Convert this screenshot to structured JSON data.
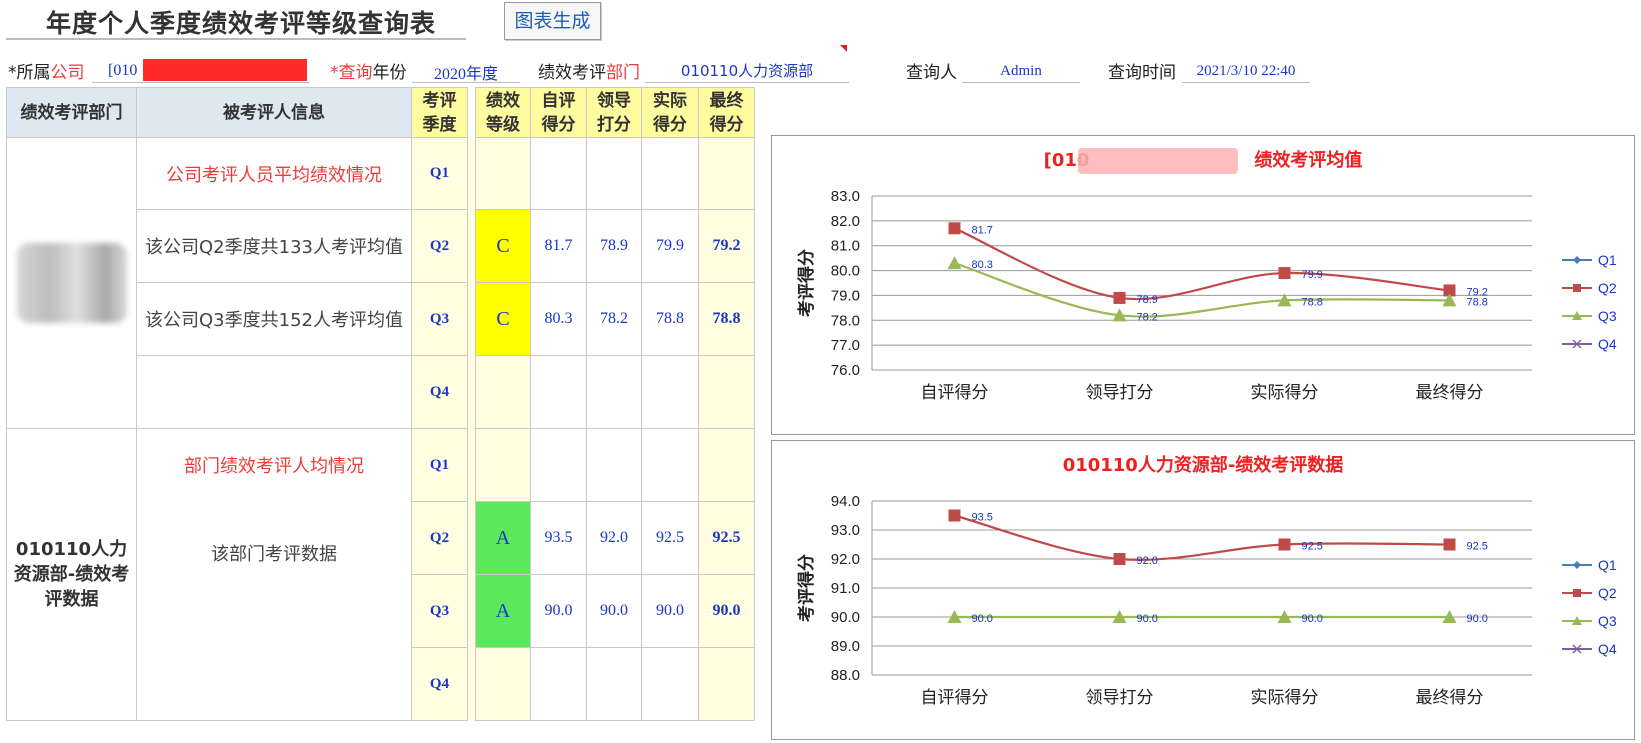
{
  "header": {
    "title": "年度个人季度绩效考评等级查询表",
    "generate_button": "图表生成"
  },
  "filters": {
    "company_label_prefix": "*所属",
    "company_label_red": "公司",
    "company_value": "[010",
    "year_label_red": "*查询",
    "year_label_suffix": "年份",
    "year_value_num": "2020",
    "year_value_suffix": "年度",
    "dept_label_prefix": "绩效考评",
    "dept_label_red": "部门",
    "dept_value": "010110人力资源部",
    "reviewer_label": "查询人",
    "reviewer_value": "Admin",
    "time_label": "查询时间",
    "time_value": "2021/3/10 22:40"
  },
  "table": {
    "headers": {
      "dept": "绩效考评部门",
      "info": "被考评人信息",
      "quarter_l1": "考评",
      "quarter_l2": "季度",
      "grade_l1": "绩效",
      "grade_l2": "等级",
      "self_l1": "自评",
      "self_l2": "得分",
      "leader_l1": "领导",
      "leader_l2": "打分",
      "actual_l1": "实际",
      "actual_l2": "得分",
      "final_l1": "最终",
      "final_l2": "得分"
    },
    "company_section": {
      "title": "公司考评人员平均绩效情况",
      "rows": [
        {
          "quarter": "Q1",
          "info": "",
          "grade": "",
          "self": "",
          "leader": "",
          "actual": "",
          "final": ""
        },
        {
          "quarter": "Q2",
          "info": "该公司Q2季度共133人考评均值",
          "grade": "C",
          "self": "81.7",
          "leader": "78.9",
          "actual": "79.9",
          "final": "79.2"
        },
        {
          "quarter": "Q3",
          "info": "该公司Q3季度共152人考评均值",
          "grade": "C",
          "self": "80.3",
          "leader": "78.2",
          "actual": "78.8",
          "final": "78.8"
        },
        {
          "quarter": "Q4",
          "info": "",
          "grade": "",
          "self": "",
          "leader": "",
          "actual": "",
          "final": ""
        }
      ]
    },
    "dept_section": {
      "dept_name": "010110人力资源部-绩效考评数据",
      "title": "部门绩效考评人均情况",
      "info": "该部门考评数据",
      "rows": [
        {
          "quarter": "Q1",
          "grade": "",
          "self": "",
          "leader": "",
          "actual": "",
          "final": ""
        },
        {
          "quarter": "Q2",
          "grade": "A",
          "self": "93.5",
          "leader": "92.0",
          "actual": "92.5",
          "final": "92.5"
        },
        {
          "quarter": "Q3",
          "grade": "A",
          "self": "90.0",
          "leader": "90.0",
          "actual": "90.0",
          "final": "90.0"
        },
        {
          "quarter": "Q4",
          "grade": "",
          "self": "",
          "leader": "",
          "actual": "",
          "final": ""
        }
      ]
    }
  },
  "colors": {
    "Q1": "#4a7ebb",
    "Q2": "#be4b48",
    "Q3": "#98b954",
    "Q4": "#7d60a0"
  },
  "chart_data": [
    {
      "type": "line",
      "title": "[010",
      "title_suffix": "绩效考评均值",
      "ylabel": "考评得分",
      "categories": [
        "自评得分",
        "领导打分",
        "实际得分",
        "最终得分"
      ],
      "ylim": [
        76.0,
        83.0
      ],
      "ystep": 1.0,
      "legend": "right",
      "series": [
        {
          "name": "Q1",
          "values": []
        },
        {
          "name": "Q2",
          "values": [
            81.7,
            78.9,
            79.9,
            79.2
          ]
        },
        {
          "name": "Q3",
          "values": [
            80.3,
            78.2,
            78.8,
            78.8
          ]
        },
        {
          "name": "Q4",
          "values": []
        }
      ]
    },
    {
      "type": "line",
      "title": "010110人力资源部-绩效考评数据",
      "title_suffix": "",
      "ylabel": "考评得分",
      "categories": [
        "自评得分",
        "领导打分",
        "实际得分",
        "最终得分"
      ],
      "ylim": [
        88.0,
        94.0
      ],
      "ystep": 1.0,
      "legend": "right",
      "series": [
        {
          "name": "Q1",
          "values": []
        },
        {
          "name": "Q2",
          "values": [
            93.5,
            92.0,
            92.5,
            92.5
          ]
        },
        {
          "name": "Q3",
          "values": [
            90.0,
            90.0,
            90.0,
            90.0
          ]
        },
        {
          "name": "Q4",
          "values": []
        }
      ]
    }
  ]
}
